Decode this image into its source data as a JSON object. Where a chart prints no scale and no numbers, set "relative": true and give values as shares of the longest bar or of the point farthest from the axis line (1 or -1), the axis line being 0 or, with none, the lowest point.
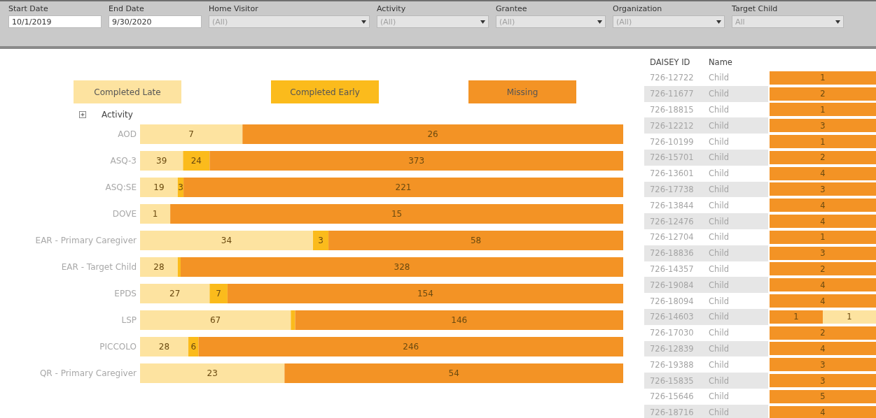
{
  "filters": [
    {
      "kind": "date",
      "label": "Start Date",
      "value": "10/1/2019"
    },
    {
      "kind": "date",
      "label": "End Date",
      "value": "9/30/2020"
    },
    {
      "kind": "dropdown",
      "label": "Home Visitor",
      "value": "(All)"
    },
    {
      "kind": "dropdown",
      "label": "Activity",
      "value": "(All)"
    },
    {
      "kind": "dropdown",
      "label": "Grantee",
      "value": "(All)"
    },
    {
      "kind": "dropdown",
      "label": "Organization",
      "value": "(All)"
    },
    {
      "kind": "dropdown",
      "label": "Target Child",
      "value": "All"
    }
  ],
  "activity_chart": {
    "header": "Activity",
    "chart_data": {
      "type": "bar",
      "orientation": "horizontal",
      "stacked": true,
      "relative": true,
      "categories": [
        "AOD",
        "ASQ-3",
        "ASQ:SE",
        "DOVE",
        "EAR - Primary Caregiver",
        "EAR - Target Child",
        "EPDS",
        "LSP",
        "PICCOLO",
        "QR - Primary Caregiver"
      ],
      "series": [
        {
          "name": "Completed Late",
          "color": "#fde3a0",
          "values": [
            0.212,
            0.089,
            0.078,
            0.0625,
            0.358,
            0.078,
            0.144,
            0.312,
            0.1,
            0.299
          ]
        },
        {
          "name": "Completed Early",
          "color": "#fbbb1c",
          "values": [
            0,
            0.055,
            0.012,
            0,
            0.032,
            0.006,
            0.037,
            0.009,
            0.021,
            0
          ]
        },
        {
          "name": "Missing",
          "color": "#f39325",
          "values": [
            0.788,
            0.856,
            0.91,
            0.9375,
            0.61,
            0.916,
            0.819,
            0.679,
            0.879,
            0.701
          ]
        }
      ]
    },
    "count_labels": [
      {
        "late": "7",
        "missing": "26"
      },
      {
        "late": "39",
        "early": "24",
        "missing": "373"
      },
      {
        "late": "19",
        "early": "3",
        "missing": "221"
      },
      {
        "late": "1",
        "missing": "15"
      },
      {
        "late": "34",
        "early": "3",
        "missing": "58"
      },
      {
        "late": "28",
        "missing": "328"
      },
      {
        "late": "27",
        "early": "7",
        "missing": "154"
      },
      {
        "late": "67",
        "missing": "146"
      },
      {
        "late": "28",
        "early": "6",
        "missing": "246"
      },
      {
        "late": "23",
        "missing": "54"
      }
    ]
  },
  "child_table": {
    "columns": [
      "DAISEY ID",
      "Name"
    ],
    "rows": [
      {
        "id": "726-12722",
        "name": "Child",
        "segments": [
          {
            "kind": "missing",
            "value": "1"
          }
        ]
      },
      {
        "id": "726-11677",
        "name": "Child",
        "segments": [
          {
            "kind": "missing",
            "value": "2"
          }
        ]
      },
      {
        "id": "726-18815",
        "name": "Child",
        "segments": [
          {
            "kind": "missing",
            "value": "1"
          }
        ]
      },
      {
        "id": "726-12212",
        "name": "Child",
        "segments": [
          {
            "kind": "missing",
            "value": "3"
          }
        ]
      },
      {
        "id": "726-10199",
        "name": "Child",
        "segments": [
          {
            "kind": "missing",
            "value": "1"
          }
        ]
      },
      {
        "id": "726-15701",
        "name": "Child",
        "segments": [
          {
            "kind": "missing",
            "value": "2"
          }
        ]
      },
      {
        "id": "726-13601",
        "name": "Child",
        "segments": [
          {
            "kind": "missing",
            "value": "4"
          }
        ]
      },
      {
        "id": "726-17738",
        "name": "Child",
        "segments": [
          {
            "kind": "missing",
            "value": "3"
          }
        ]
      },
      {
        "id": "726-13844",
        "name": "Child",
        "segments": [
          {
            "kind": "missing",
            "value": "4"
          }
        ]
      },
      {
        "id": "726-12476",
        "name": "Child",
        "segments": [
          {
            "kind": "missing",
            "value": "4"
          }
        ]
      },
      {
        "id": "726-12704",
        "name": "Child",
        "segments": [
          {
            "kind": "missing",
            "value": "1"
          }
        ]
      },
      {
        "id": "726-18836",
        "name": "Child",
        "segments": [
          {
            "kind": "missing",
            "value": "3"
          }
        ]
      },
      {
        "id": "726-14357",
        "name": "Child",
        "segments": [
          {
            "kind": "missing",
            "value": "2"
          }
        ]
      },
      {
        "id": "726-19084",
        "name": "Child",
        "segments": [
          {
            "kind": "missing",
            "value": "4"
          }
        ]
      },
      {
        "id": "726-18094",
        "name": "Child",
        "segments": [
          {
            "kind": "missing",
            "value": "4"
          }
        ]
      },
      {
        "id": "726-14603",
        "name": "Child",
        "segments": [
          {
            "kind": "missing",
            "value": "1"
          },
          {
            "kind": "late",
            "value": "1"
          }
        ]
      },
      {
        "id": "726-17030",
        "name": "Child",
        "segments": [
          {
            "kind": "missing",
            "value": "2"
          }
        ]
      },
      {
        "id": "726-12839",
        "name": "Child",
        "segments": [
          {
            "kind": "missing",
            "value": "4"
          }
        ]
      },
      {
        "id": "726-19388",
        "name": "Child",
        "segments": [
          {
            "kind": "missing",
            "value": "3"
          }
        ]
      },
      {
        "id": "726-15835",
        "name": "Child",
        "segments": [
          {
            "kind": "missing",
            "value": "3"
          }
        ]
      },
      {
        "id": "726-15646",
        "name": "Child",
        "segments": [
          {
            "kind": "missing",
            "value": "5"
          }
        ]
      },
      {
        "id": "726-18716",
        "name": "Child",
        "segments": [
          {
            "kind": "missing",
            "value": "4"
          }
        ]
      }
    ]
  }
}
